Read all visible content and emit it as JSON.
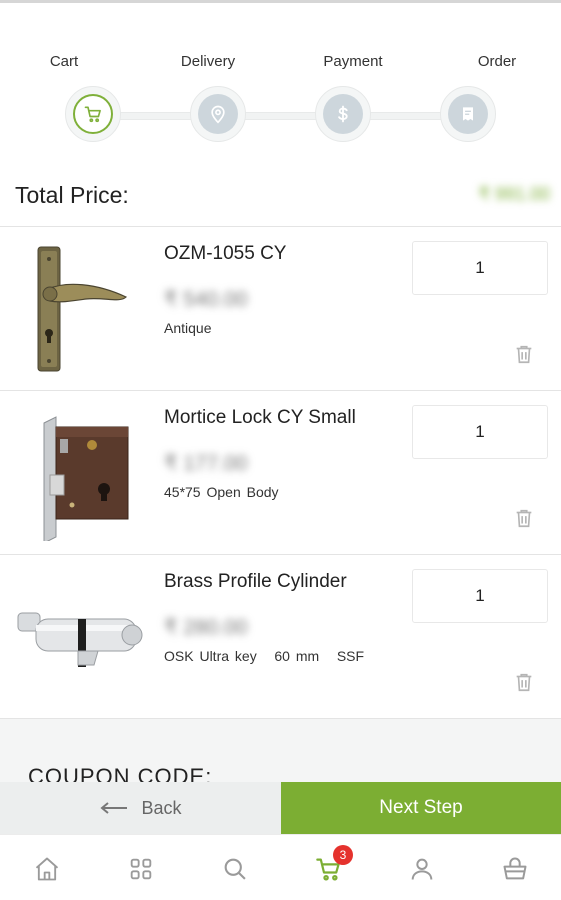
{
  "stepper": {
    "steps": [
      {
        "label": "Cart",
        "icon": "cart-icon",
        "active": true
      },
      {
        "label": "Delivery",
        "icon": "location-pin-icon",
        "active": false
      },
      {
        "label": "Payment",
        "icon": "dollar-icon",
        "active": false
      },
      {
        "label": "Order",
        "icon": "receipt-icon",
        "active": false
      }
    ]
  },
  "total": {
    "label": "Total Price:",
    "value": "₹ 991.00"
  },
  "items": [
    {
      "name": "OZM-1055 CY",
      "price": "₹ 540.00",
      "variant": "Antique",
      "quantity": "1"
    },
    {
      "name": "Mortice Lock CY Small",
      "price": "₹ 177.00",
      "variant": "45*75 Open Body",
      "quantity": "1"
    },
    {
      "name": "Brass Profile Cylinder",
      "price": "₹ 280.00",
      "variant": "OSK Ultra key   60 mm   SSF",
      "quantity": "1"
    }
  ],
  "coupon": {
    "label": "COUPON CODE:"
  },
  "actions": {
    "back_label": "Back",
    "next_label": "Next Step"
  },
  "bottom_nav": {
    "items": [
      "home-icon",
      "grid-icon",
      "search-icon",
      "cart-icon",
      "profile-icon",
      "basket-icon"
    ],
    "cart_badge": "3"
  },
  "colors": {
    "accent": "#7cae33",
    "badge": "#e5322d",
    "inactive_step": "#cdd6dc"
  }
}
